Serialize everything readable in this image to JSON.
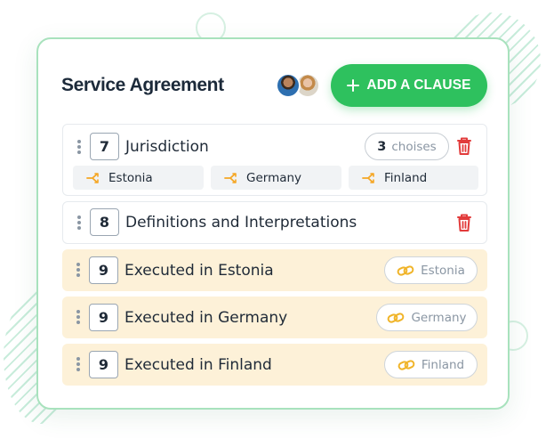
{
  "header": {
    "title": "Service Agreement",
    "add_button_label": "ADD A CLAUSE"
  },
  "avatars": [
    {
      "name": "collaborator-1"
    },
    {
      "name": "collaborator-2"
    }
  ],
  "clauses": [
    {
      "number": "7",
      "label": "Jurisdiction",
      "choices_count": "3",
      "choices_label": "choises",
      "options": [
        "Estonia",
        "Germany",
        "Finland"
      ]
    },
    {
      "number": "8",
      "label": "Definitions and Interpretations"
    },
    {
      "number": "9",
      "label": "Executed in Estonia",
      "linked_option": "Estonia"
    },
    {
      "number": "9",
      "label": "Executed in Germany",
      "linked_option": "Germany"
    },
    {
      "number": "9",
      "label": "Executed in Finland",
      "linked_option": "Finland"
    }
  ],
  "colors": {
    "accent_green": "#2ec15e",
    "card_border": "#a8e2bd",
    "linked_row_bg": "#fdf1d8",
    "delete_red": "#e23b3b",
    "branch_orange": "#f5a623",
    "link_gold": "#f0b429"
  },
  "icons": {
    "add": "plus-icon",
    "drag": "drag-handle-icon",
    "delete": "trash-icon",
    "option": "branch-icon",
    "linked": "link-icon"
  }
}
